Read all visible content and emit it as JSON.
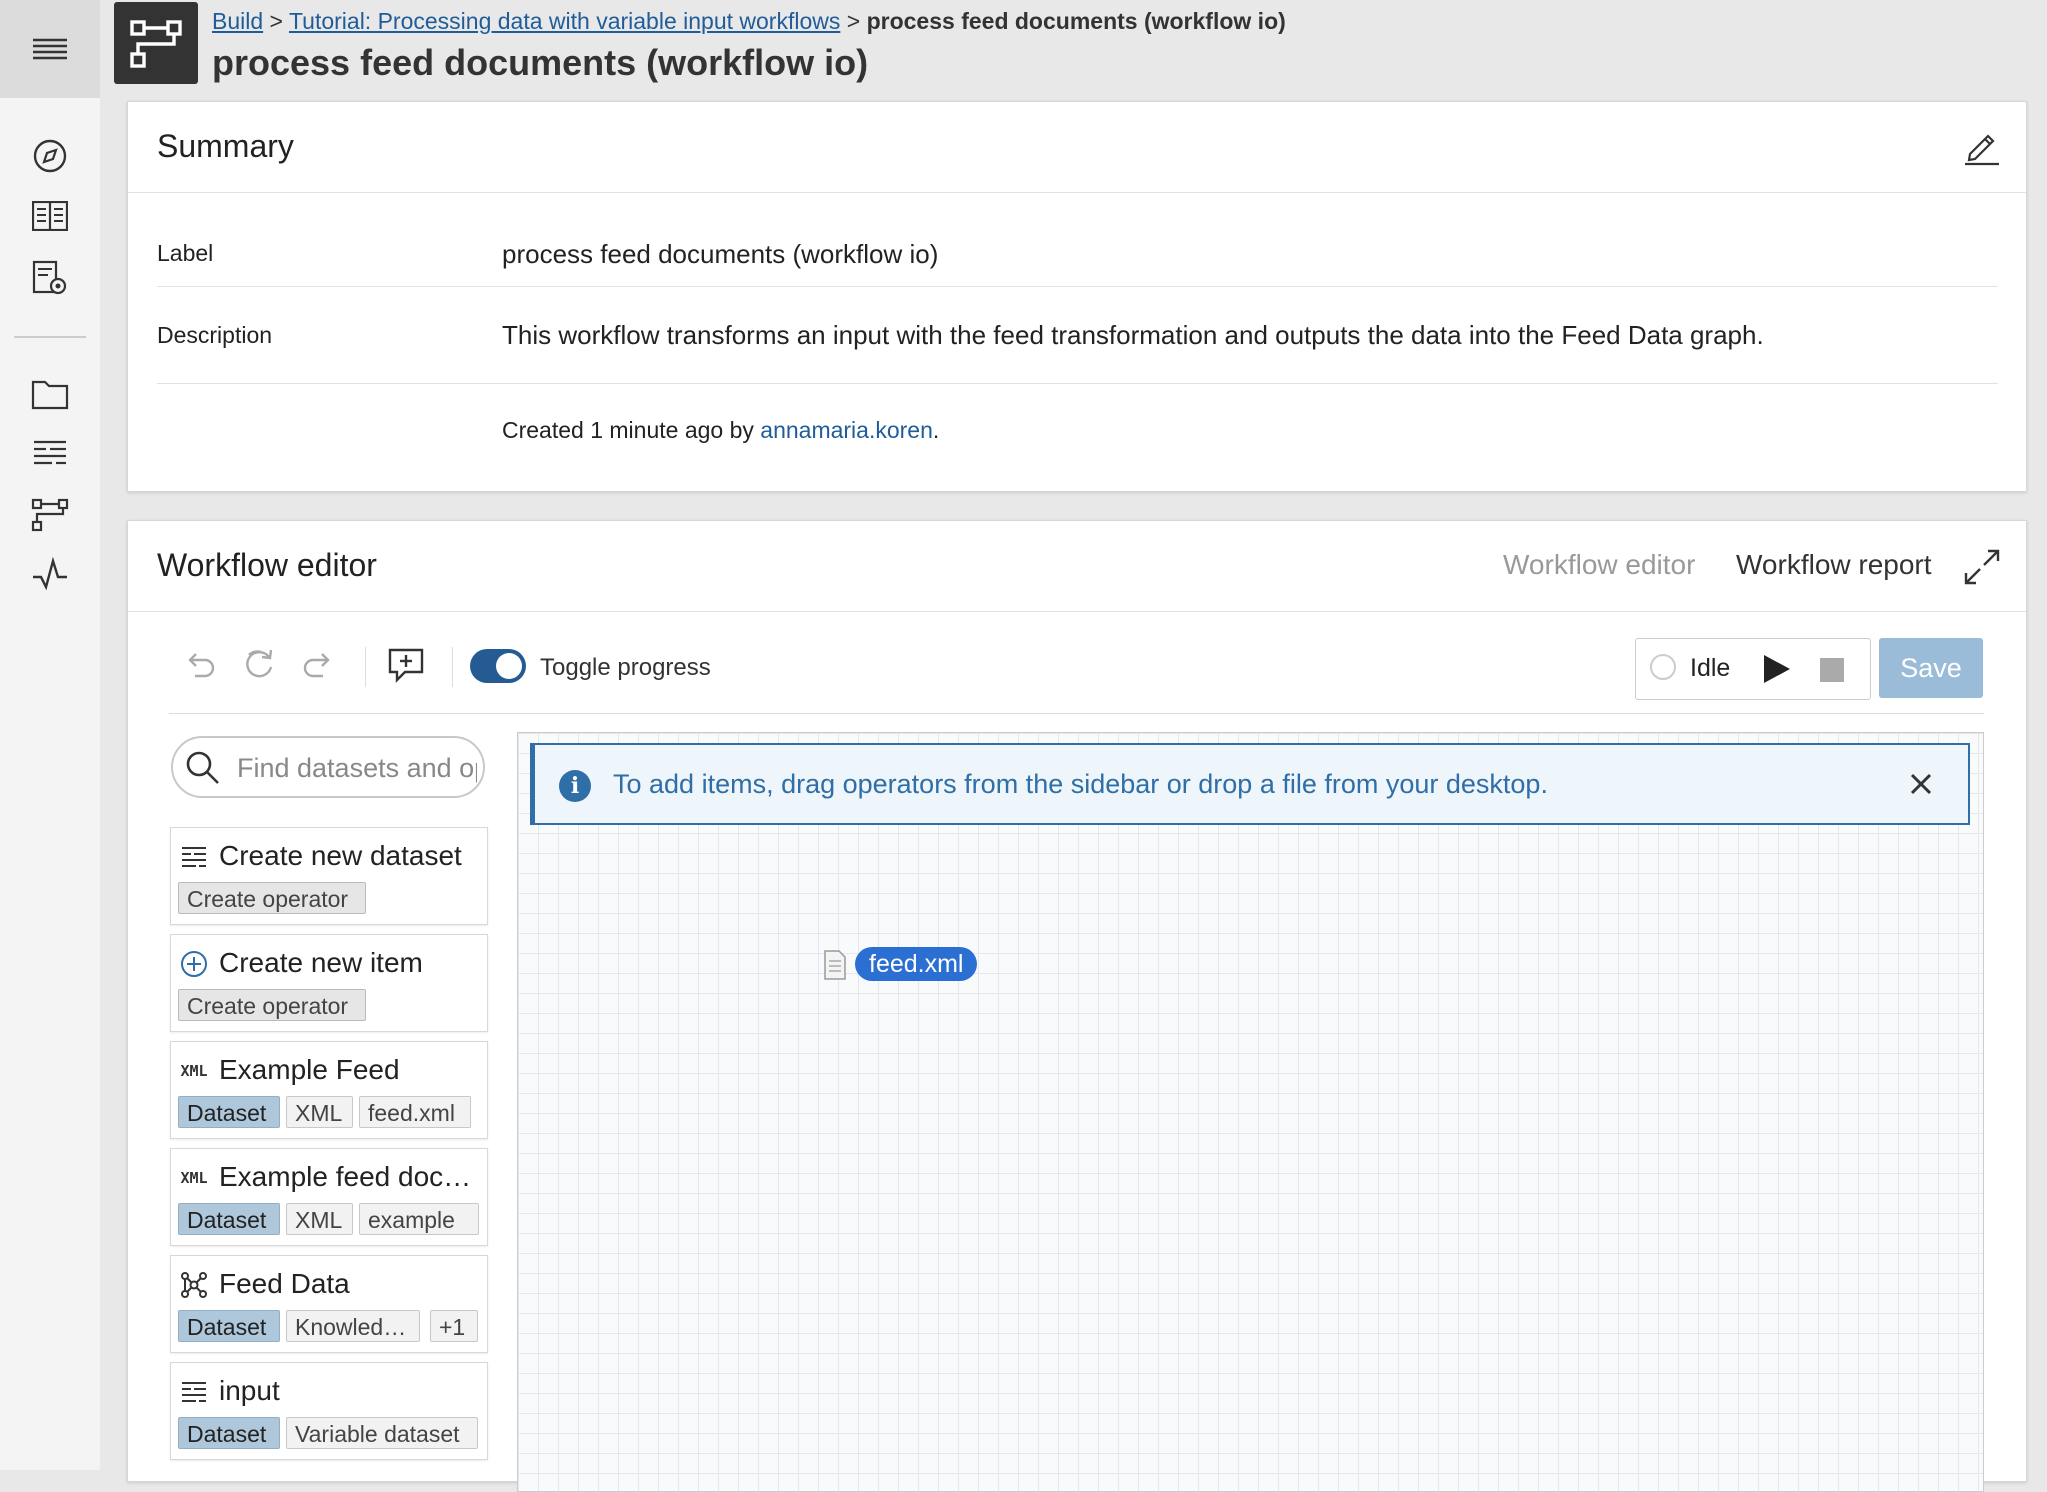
{
  "breadcrumb": {
    "items": [
      "Build",
      "Tutorial: Processing data with variable input workflows"
    ],
    "separator": ">",
    "current": "process feed documents (workflow io)"
  },
  "page": {
    "title": "process feed documents (workflow io)"
  },
  "summary": {
    "title": "Summary",
    "label_key": "Label",
    "label_value": "process feed documents (workflow io)",
    "description_key": "Description",
    "description_value": "This workflow transforms an input with the feed transformation and outputs the data into the Feed Data graph.",
    "created_prefix": "Created 1 minute ago by",
    "created_user": "annamaria.koren",
    "created_suffix": "."
  },
  "editor": {
    "title": "Workflow editor",
    "tabs": [
      {
        "label": "Workflow editor",
        "active": true
      },
      {
        "label": "Workflow report",
        "active": false
      }
    ],
    "toolbar": {
      "toggle_label": "Toggle progress",
      "toggle_on": true,
      "status": "Idle",
      "save_label": "Save"
    },
    "search": {
      "placeholder": "Find datasets and operators",
      "value": ""
    },
    "sidebar_items": [
      {
        "icon": "dataset-list-icon",
        "title": "Create new dataset",
        "tags": [
          "Create operator"
        ]
      },
      {
        "icon": "plus-circle-icon",
        "title": "Create new item",
        "tags": [
          "Create operator"
        ]
      },
      {
        "icon": "xml-icon",
        "title": "Example Feed",
        "tags": [
          "Dataset",
          "XML",
          "feed.xml"
        ]
      },
      {
        "icon": "xml-icon",
        "title": "Example feed documents",
        "tags": [
          "Dataset",
          "XML",
          "example"
        ]
      },
      {
        "icon": "knowledge-graph-icon",
        "title": "Feed Data",
        "tags": [
          "Dataset",
          "Knowledge Graph",
          "+1"
        ]
      },
      {
        "icon": "dataset-list-icon",
        "title": "input",
        "tags": [
          "Dataset",
          "Variable dataset"
        ]
      }
    ],
    "xml_icon_text": "XML",
    "info_message": "To add items, drag operators from the sidebar or drop a file from your desktop.",
    "canvas_node": {
      "label": "feed.xml",
      "icon": "file-icon"
    }
  },
  "colors": {
    "accent": "#2f6ea6",
    "link": "#1f5c99",
    "toggle": "#245b92",
    "node": "#2c6fd3",
    "save_disabled": "#9bbcd9",
    "dataset_tag": "#aec7db"
  }
}
